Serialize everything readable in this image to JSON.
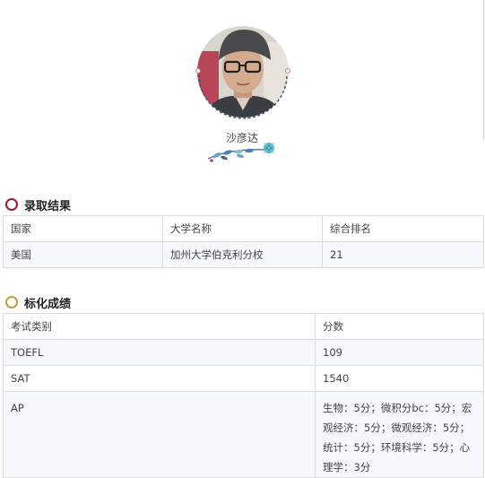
{
  "profile": {
    "name": "沙彦达"
  },
  "admission": {
    "title": "录取结果",
    "accent": "#9c1a2c",
    "columns": [
      "国家",
      "大学名称",
      "综合排名"
    ],
    "rows": [
      [
        "美国",
        "加州大学伯克利分校",
        "21"
      ]
    ]
  },
  "scores": {
    "title": "标化成绩",
    "accent": "#c99a3b",
    "columns": [
      "考试类别",
      "分数"
    ],
    "rows": [
      [
        "TOEFL",
        "109"
      ],
      [
        "SAT",
        "1540"
      ],
      [
        "AP",
        "生物：5分；微积分bc：5分；宏观经济：5分；微观经济：5分；统计：5分；环境科学：5分；心理学：3分"
      ]
    ]
  }
}
